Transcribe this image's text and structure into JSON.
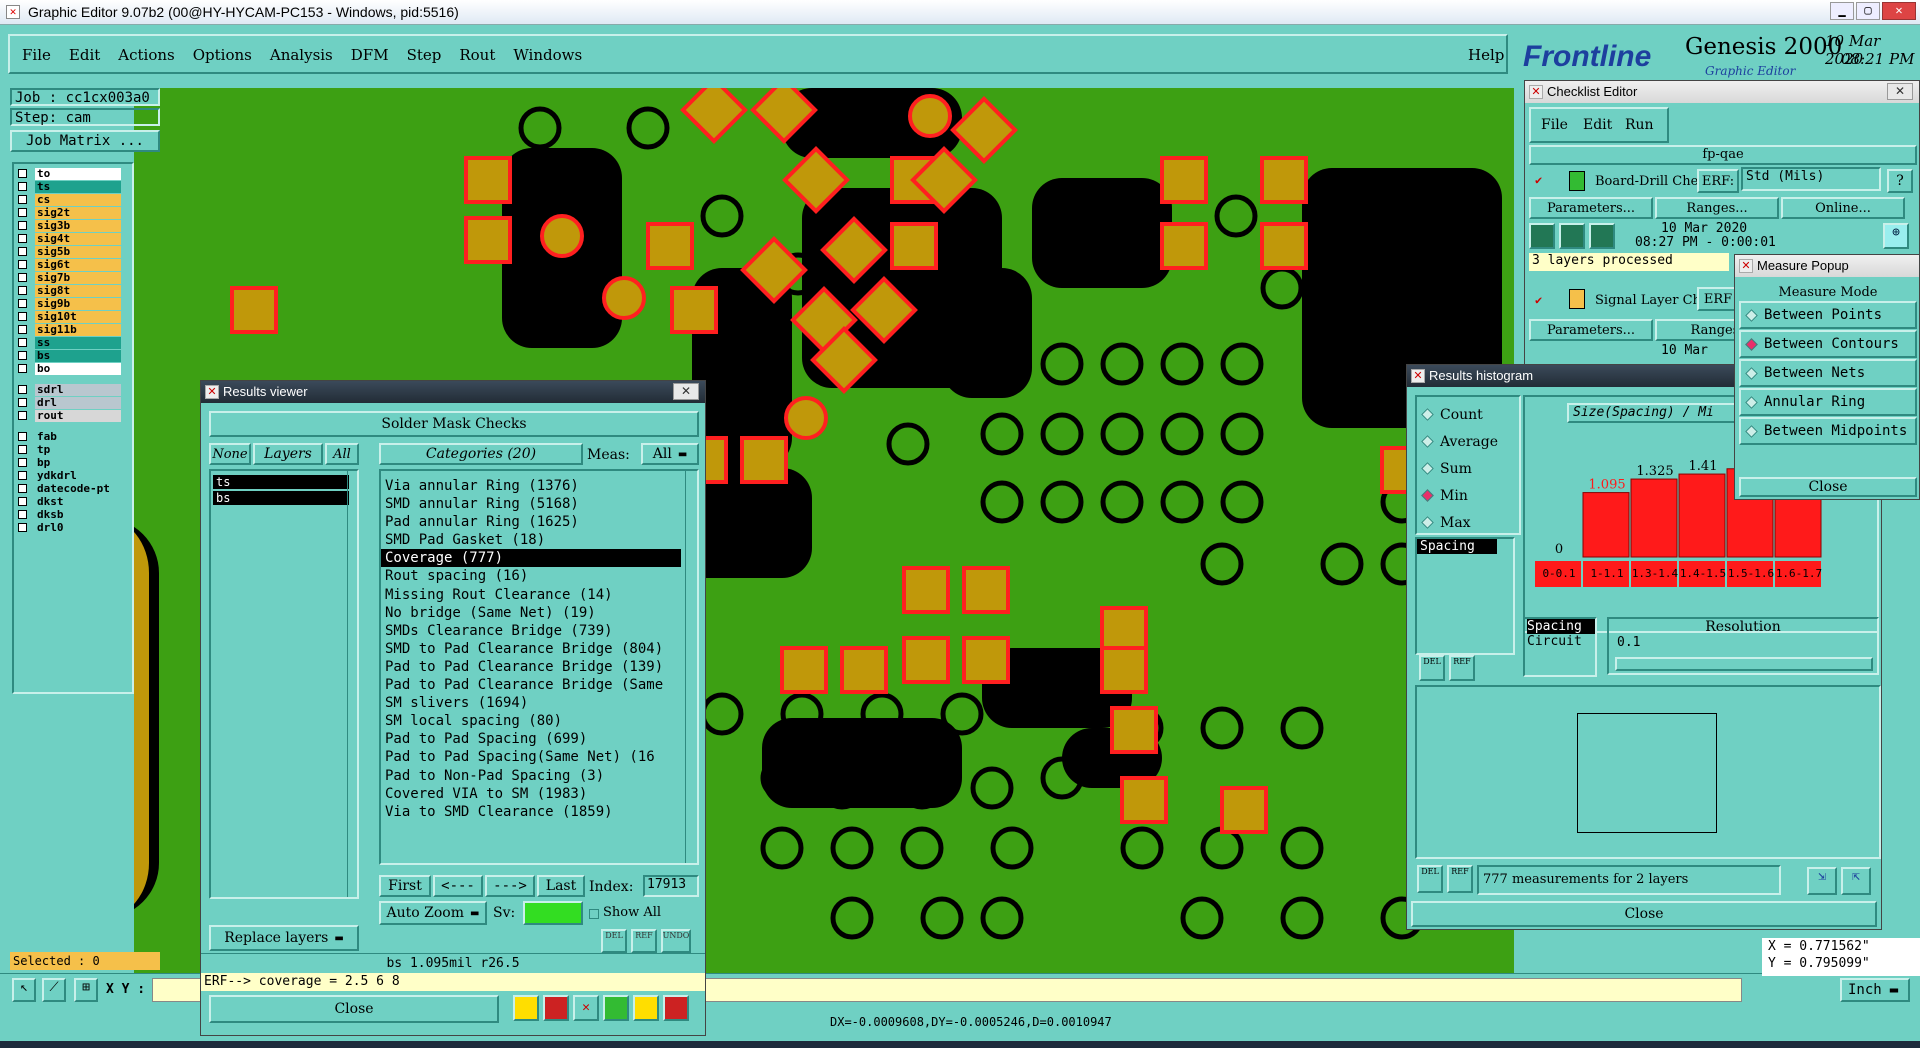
{
  "window": {
    "title": "Graphic Editor 9.07b2 (00@HY-HYCAM-PC153 - Windows, pid:5516)"
  },
  "menu": [
    "File",
    "Edit",
    "Actions",
    "Options",
    "Analysis",
    "DFM",
    "Step",
    "Rout",
    "Windows"
  ],
  "help_label": "Help",
  "brand": {
    "logo": "Frontline",
    "product": "Genesis 2000",
    "subtitle": "Graphic Editor",
    "date": "10 Mar 2020",
    "time": "08:21 PM"
  },
  "job": {
    "job_label": "Job : cc1cx003a0",
    "step_label": "Step: cam",
    "matrix_button": "Job Matrix ..."
  },
  "layers_group1": [
    {
      "name": "to",
      "color": "#ffffff"
    },
    {
      "name": "ts",
      "color": "#1ea28e"
    },
    {
      "name": "cs",
      "color": "#f5c04a"
    },
    {
      "name": "sig2t",
      "color": "#f5c04a"
    },
    {
      "name": "sig3b",
      "color": "#f5c04a"
    },
    {
      "name": "sig4t",
      "color": "#f5c04a"
    },
    {
      "name": "sig5b",
      "color": "#f5c04a"
    },
    {
      "name": "sig6t",
      "color": "#f5c04a"
    },
    {
      "name": "sig7b",
      "color": "#f5c04a"
    },
    {
      "name": "sig8t",
      "color": "#f5c04a"
    },
    {
      "name": "sig9b",
      "color": "#f5c04a"
    },
    {
      "name": "sig10t",
      "color": "#f5c04a"
    },
    {
      "name": "sig11b",
      "color": "#f5c04a"
    },
    {
      "name": "ss",
      "color": "#1ea28e"
    },
    {
      "name": "bs",
      "color": "#1ea28e"
    },
    {
      "name": "bo",
      "color": "#ffffff"
    }
  ],
  "layers_group2": [
    {
      "name": "sdrl",
      "color": "#b9c7cf"
    },
    {
      "name": "drl",
      "color": "#b9c7cf"
    },
    {
      "name": "rout",
      "color": "#d7d7d7"
    }
  ],
  "layers_group3": [
    {
      "name": "fab",
      "color": "#6fd0c3"
    },
    {
      "name": "tp",
      "color": "#6fd0c3"
    },
    {
      "name": "bp",
      "color": "#6fd0c3"
    },
    {
      "name": "ydkdrl",
      "color": "#6fd0c3"
    },
    {
      "name": "datecode-pt",
      "color": "#6fd0c3"
    },
    {
      "name": "dkst",
      "color": "#6fd0c3"
    },
    {
      "name": "dksb",
      "color": "#6fd0c3"
    },
    {
      "name": "drl0",
      "color": "#6fd0c3"
    }
  ],
  "status": {
    "selected": "Selected : 0",
    "xy_label": "X Y :",
    "dxdy": "DX=-0.0009608,DY=-0.0005246,D=0.0010947",
    "x_coord": "X = 0.771562\"",
    "y_coord": "Y = 0.795099\"",
    "units": "Inch"
  },
  "results_viewer": {
    "title": "Results viewer",
    "header": "Solder Mask Checks",
    "none_btn": "None",
    "layers_btn": "Layers",
    "all_btn": "All",
    "categories_btn": "Categories (20)",
    "meas_label": "Meas:",
    "meas_value": "All",
    "layers": [
      "ts",
      "bs"
    ],
    "categories": [
      "Via annular Ring (1376)",
      "SMD annular Ring (5168)",
      "Pad annular Ring (1625)",
      "SMD Pad Gasket (18)",
      "Coverage (777)",
      "Rout spacing (16)",
      "Missing Rout Clearance (14)",
      "No bridge (Same Net) (19)",
      "SMDs Clearance Bridge (739)",
      "SMD to Pad Clearance Bridge (804)",
      "Pad to Pad Clearance Bridge (139)",
      "Pad to Pad Clearance Bridge (Same",
      "SM slivers (1694)",
      "SM local spacing (80)",
      "Pad to Pad Spacing (699)",
      "Pad to Pad Spacing(Same Net) (16",
      "Pad to Non-Pad Spacing (3)",
      "Covered VIA to SM (1983)",
      "Via to SMD Clearance (1859)"
    ],
    "selected_index": 4,
    "first": "First",
    "prev": "<---",
    "next": "--->",
    "last": "Last",
    "index_label": "Index:",
    "index_value": "17913",
    "autozoom": "Auto Zoom",
    "sv_label": "Sv:",
    "show_all": "Show All",
    "replace": "Replace layers",
    "del": "DEL",
    "ref": "REF",
    "undo": "UNDO",
    "info": "bs 1.095mil  r26.5",
    "erf": "ERF--> coverage = 2.5 6 8",
    "close": "Close"
  },
  "checklist": {
    "title": "Checklist Editor",
    "menu": [
      "File",
      "Edit",
      "Run"
    ],
    "name": "fp-qae",
    "check1": "Board-Drill Che",
    "erf_btn": "ERF:",
    "std": "Std (Mils)",
    "q": "?",
    "params": "Parameters...",
    "ranges": "Ranges...",
    "online": "Online...",
    "date": "10 Mar 2020",
    "time": "08:27 PM - 0:00:01",
    "processed": "3 layers processed",
    "check2": "Signal Layer Ch",
    "erf2": "ERF",
    "params2": "Parameters...",
    "ranges2": "Ranges.",
    "mar": "10 Mar"
  },
  "measure": {
    "title": "Measure Popup",
    "mode": "Measure Mode",
    "options": [
      "Between Points",
      "Between Contours",
      "Between Nets",
      "Annular Ring",
      "Between Midpoints"
    ],
    "selected": 1,
    "close": "Close"
  },
  "histogram": {
    "title": "Results histogram",
    "stats": [
      "Count",
      "Average",
      "Sum",
      "Min",
      "Max"
    ],
    "selected_stat": 3,
    "size_label": "Size(Spacing) / Mi",
    "spacing": "Spacing",
    "spacing2": "Spacing",
    "circuit": "Circuit",
    "resolution": "Resolution",
    "res_value": "0.1",
    "summary": "777 measurements for 2 layers",
    "del": "DEL",
    "ref": "REF",
    "close": "Close"
  },
  "chart_data": {
    "type": "bar",
    "categories": [
      "0-0.1",
      "1-1.1",
      "1.3-1.4",
      "1.4-1.5",
      "1.5-1.6",
      "1.6-1.7"
    ],
    "values": [
      0,
      1.095,
      1.325,
      1.41,
      1.5,
      1.6
    ],
    "labels": [
      "0",
      "1.095",
      "1.325",
      "1.41",
      "",
      ""
    ],
    "ylim": [
      0,
      1.7
    ]
  },
  "colors": {
    "board": "#3da013",
    "pad": "#c0980a",
    "outline": "#ff2020",
    "mask": "#000000",
    "panel": "#6fd0c3"
  }
}
